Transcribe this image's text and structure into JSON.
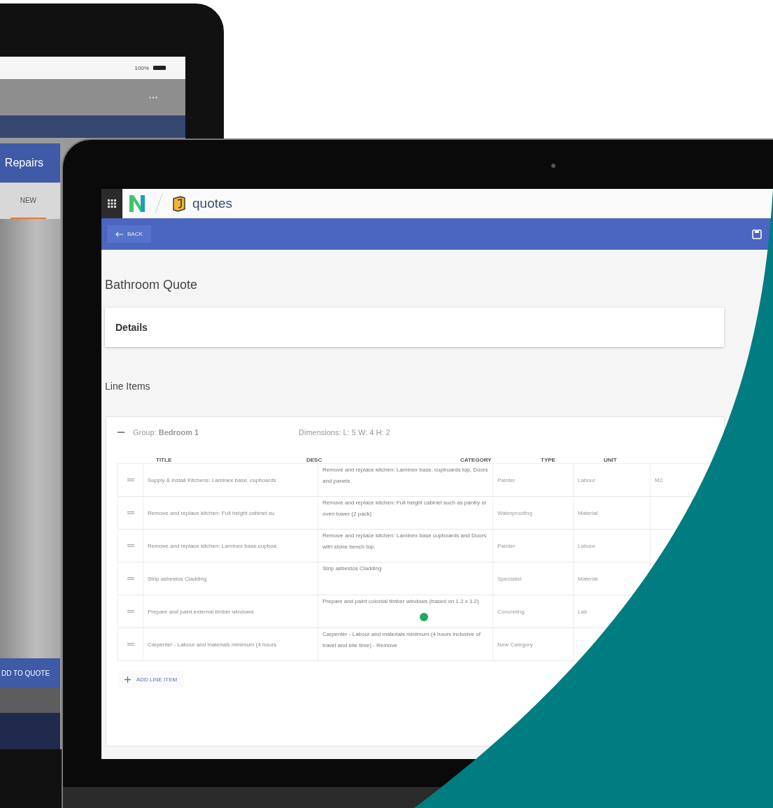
{
  "tablet": {
    "status": {
      "battery": "100%"
    },
    "header": {
      "title": "Repairs"
    },
    "tabs": [
      {
        "label": "NEW",
        "selected": true
      }
    ],
    "action_button": "DD TO QUOTE"
  },
  "laptop": {
    "app": {
      "name": "quotes"
    },
    "toolbar": {
      "back": "BACK"
    },
    "page_title": "Bathroom Quote",
    "details": {
      "title": "Details"
    },
    "line_items": {
      "title": "Line Items",
      "group": {
        "expanded": true,
        "label": "Group: **Bedroom 1**",
        "dimensions": "Dimensions: L: 5 W: 4 H: 2"
      },
      "columns": [
        "TITLE",
        "DESC",
        "CATEGORY",
        "TYPE",
        "UNIT"
      ],
      "rows": [
        {
          "title": "Supply & install Kitchens: Laminex base, cupboards",
          "desc": "Remove and replace kitchen: Laminex base, cupboards top, Doors and panels",
          "category": "Painter",
          "type": "Labour",
          "column_6": "M2"
        },
        {
          "title": "Remove and replace kitchen: Full height cabinet su",
          "desc": "Remove and replace kitchen: Full height cabinet such as pantry or oven tower (2 pack)",
          "category": "Waterproofing",
          "type": "Material"
        },
        {
          "title": "Remove and replace kitchen: Laminex base cupboa",
          "desc": "Remove and replace kitchen: Laminex base cupboards and Doors with stone bench top.",
          "category": "Painter",
          "type": "Labour"
        },
        {
          "title": "Strip asbestos Cladding",
          "desc": "Strip asbestos Cladding",
          "category": "Specialist",
          "type": "Material"
        },
        {
          "title": "Prepare and paint external timber windows",
          "desc": "Prepare and paint colonial timber windows (based on 1.2 x 1.2)",
          "category": "Concreting",
          "type": "Lab"
        },
        {
          "title": "Carpenter - Labour and materials minimum (4 hours",
          "desc": "Carpenter - Labour and materials minimum (4 hours inclusive of travel and site time) - Remove",
          "category": "New Category"
        }
      ],
      "add_button": "ADD LINE ITEM"
    }
  }
}
